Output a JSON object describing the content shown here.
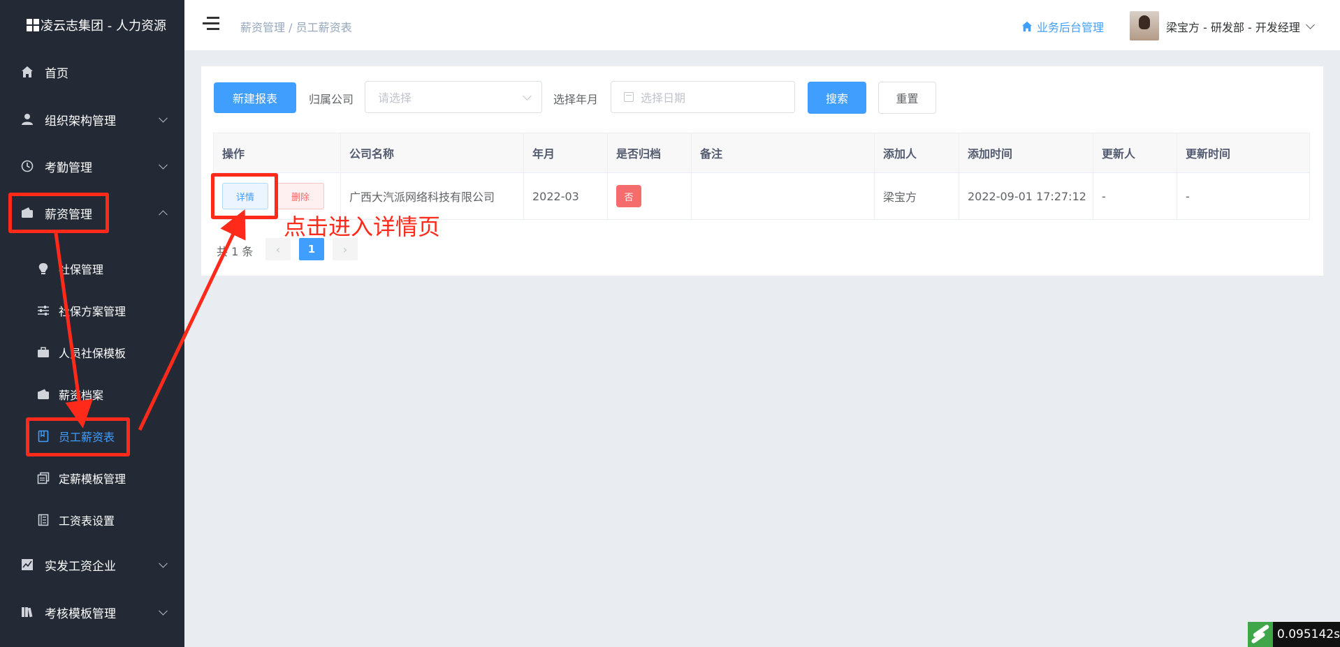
{
  "app": {
    "title": "凌云志集团 - 人力资源"
  },
  "sidebar": {
    "menu": [
      {
        "label": "首页",
        "icon": "home-icon"
      },
      {
        "label": "组织架构管理",
        "icon": "user-icon"
      },
      {
        "label": "考勤管理",
        "icon": "clock-icon"
      },
      {
        "label": "薪资管理",
        "icon": "wallet-icon"
      },
      {
        "label": "实发工资企业",
        "icon": "chart-icon"
      },
      {
        "label": "考核模板管理",
        "icon": "book-icon"
      }
    ],
    "submenu": [
      {
        "label": "社保管理",
        "icon": "bulb-icon"
      },
      {
        "label": "社保方案管理",
        "icon": "sliders-icon"
      },
      {
        "label": "人员社保模板",
        "icon": "briefcase-icon"
      },
      {
        "label": "薪资档案",
        "icon": "wallet-icon"
      },
      {
        "label": "员工薪资表",
        "icon": "notebook-icon"
      },
      {
        "label": "定薪模板管理",
        "icon": "copy-icon"
      },
      {
        "label": "工资表设置",
        "icon": "list-icon"
      }
    ]
  },
  "header": {
    "breadcrumb": "薪资管理 / 员工薪资表",
    "backend_link": "业务后台管理",
    "user": "梁宝方 - 研发部 - 开发经理"
  },
  "toolbar": {
    "new_report": "新建报表",
    "company_label": "归属公司",
    "company_placeholder": "请选择",
    "month_label": "选择年月",
    "month_placeholder": "选择日期",
    "search": "搜索",
    "reset": "重置"
  },
  "table": {
    "columns": [
      "操作",
      "公司名称",
      "年月",
      "是否归档",
      "备注",
      "添加人",
      "添加时间",
      "更新人",
      "更新时间"
    ],
    "rows": [
      {
        "detail": "详情",
        "delete": "删除",
        "company": "广西大汽派网络科技有限公司",
        "month": "2022-03",
        "archived": "否",
        "remark": "",
        "creator": "梁宝方",
        "created_at": "2022-09-01 17:27:12",
        "updater": "-",
        "updated_at": "-"
      }
    ]
  },
  "pagination": {
    "total_text": "共 1 条",
    "current_page": "1"
  },
  "annotation": {
    "text": "点击进入详情页",
    "color": "#ff2a1a"
  },
  "perf_widget": {
    "value": "0.095142s"
  },
  "colors": {
    "primary": "#409eff",
    "sidebar_bg": "#232a35",
    "danger": "#f56c6c"
  }
}
